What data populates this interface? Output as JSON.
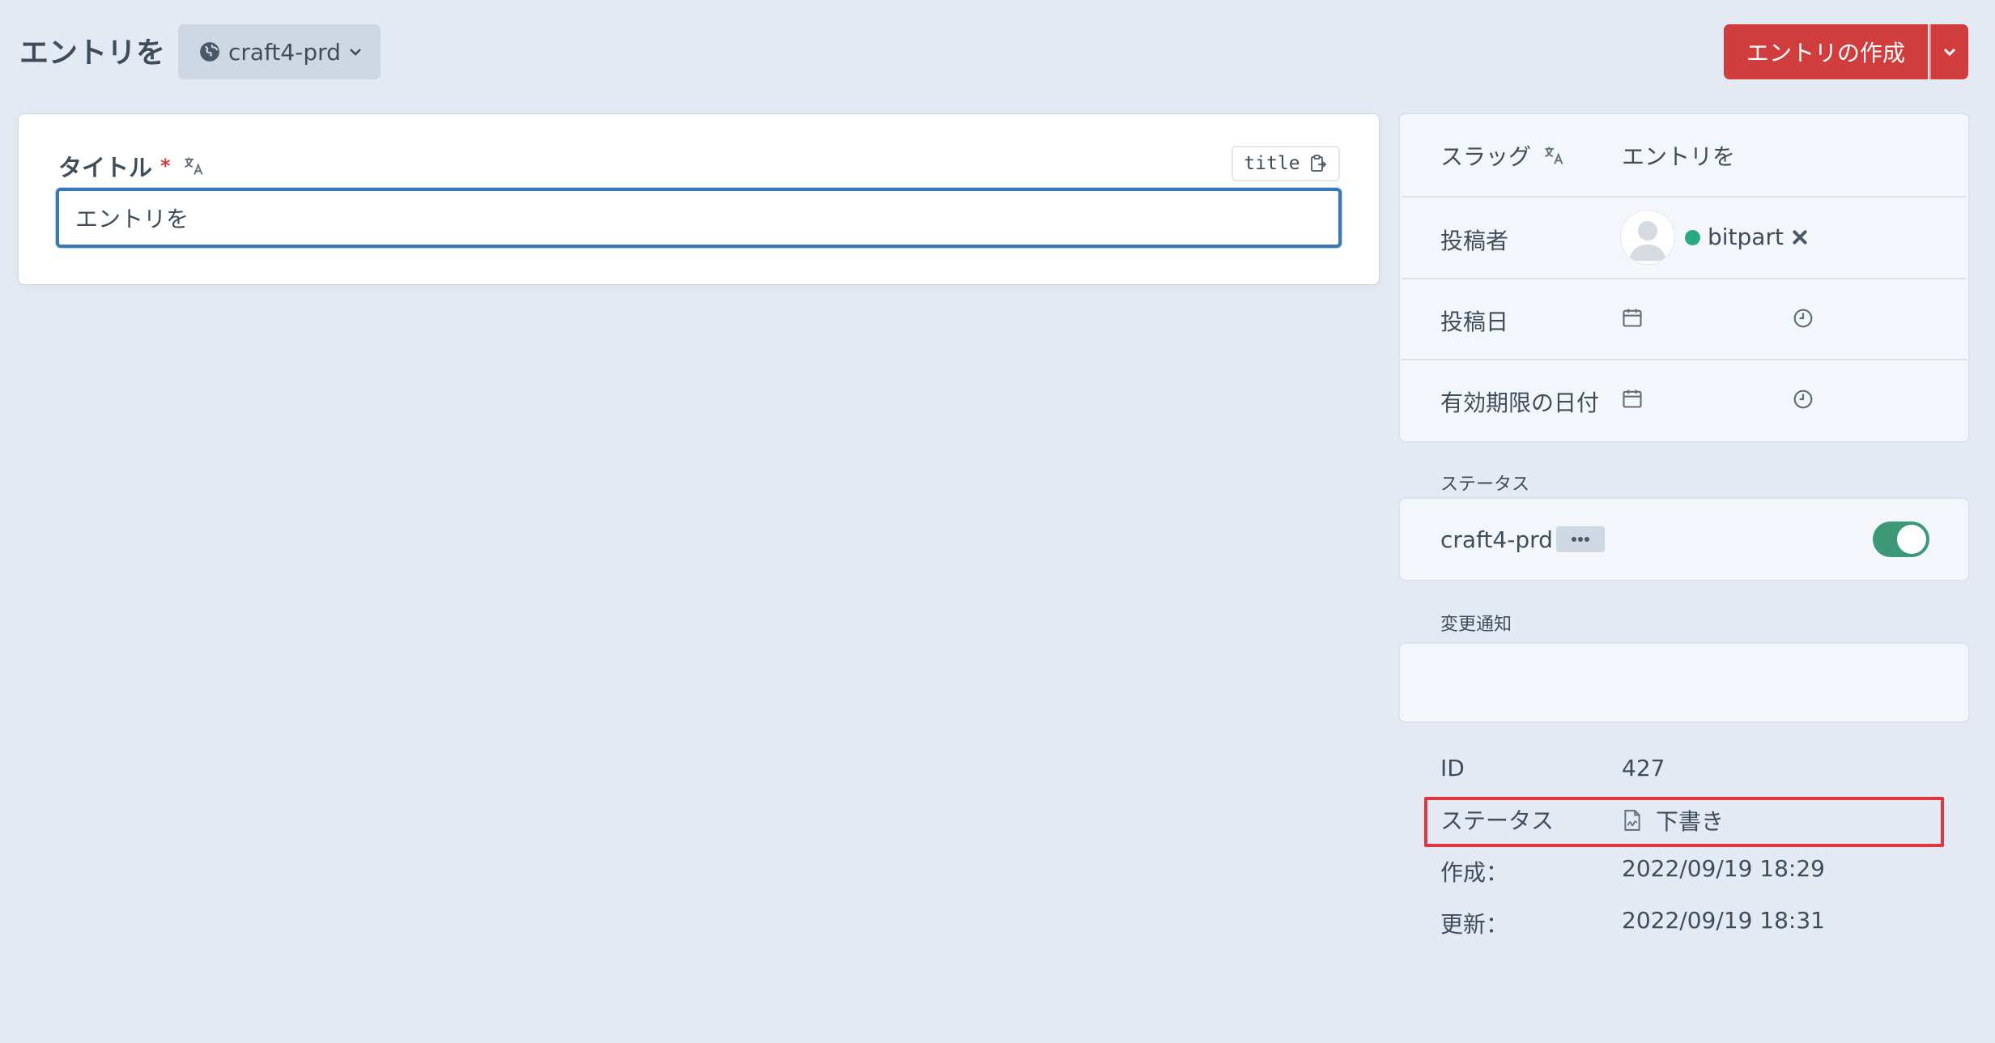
{
  "header": {
    "title": "エントリを",
    "site_selector": "craft4-prd",
    "create_button": "エントリの作成"
  },
  "title_field": {
    "label": "タイトル",
    "required_mark": "*",
    "handle": "title",
    "value": "エントリを"
  },
  "meta": {
    "slug_label": "スラッグ",
    "slug_value": "エントリを",
    "author_label": "投稿者",
    "author_name": "bitpart",
    "post_date_label": "投稿日",
    "expiry_date_label": "有効期限の日付"
  },
  "status_section": {
    "heading": "ステータス",
    "site_name": "craft4-prd",
    "enabled": true
  },
  "notification_section": {
    "heading": "変更通知"
  },
  "info": {
    "id_label": "ID",
    "id_value": "427",
    "status_label": "ステータス",
    "status_value": "下書き",
    "created_label": "作成：",
    "created_value": "2022/09/19 18:29",
    "updated_label": "更新：",
    "updated_value": "2022/09/19 18:31"
  },
  "colors": {
    "background": "#e4eaf3",
    "primary_button": "#d13c3c",
    "toggle_on": "#3c9876",
    "status_dot": "#27ab83",
    "input_focus": "#3a77b5",
    "highlight": "#e0363f"
  }
}
